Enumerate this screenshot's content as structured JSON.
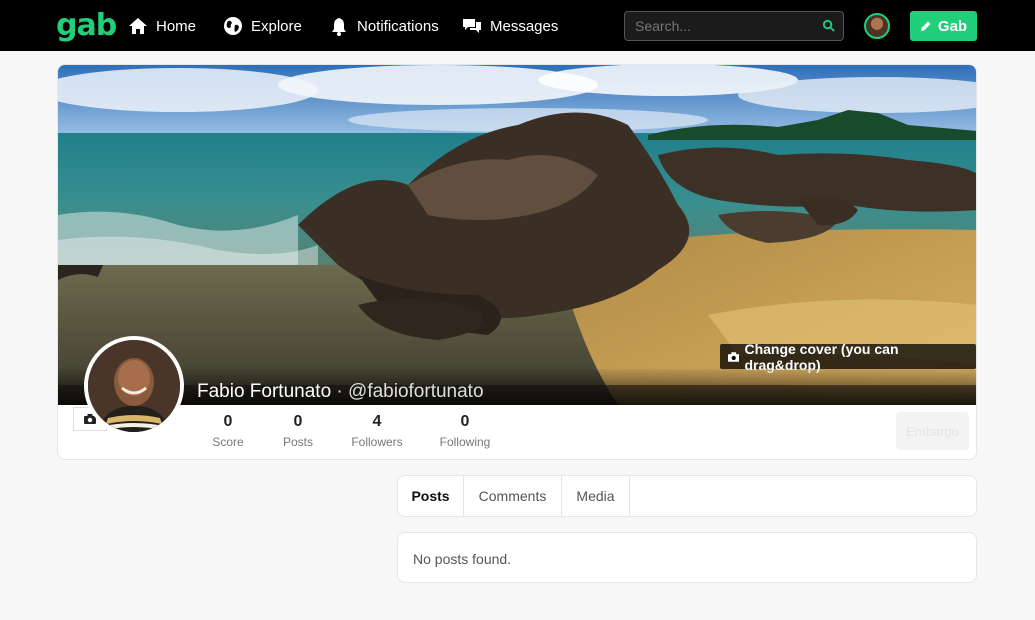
{
  "nav": {
    "logo": "gab",
    "items": [
      {
        "label": "Home",
        "icon": "home-icon"
      },
      {
        "label": "Explore",
        "icon": "globe-icon"
      },
      {
        "label": "Notifications",
        "icon": "bell-icon"
      },
      {
        "label": "Messages",
        "icon": "chat-icon"
      }
    ],
    "search_placeholder": "Search...",
    "gab_button_label": "Gab"
  },
  "profile": {
    "display_name": "Fabio Fortunato",
    "separator": "·",
    "handle": "@fabiofortunato",
    "change_cover_label": "Change cover (you can drag&drop)",
    "stats": [
      {
        "value": "0",
        "label": "Score"
      },
      {
        "value": "0",
        "label": "Posts"
      },
      {
        "value": "4",
        "label": "Followers"
      },
      {
        "value": "0",
        "label": "Following"
      }
    ],
    "action_label": "Embargo"
  },
  "tabs": [
    {
      "label": "Posts",
      "active": true
    },
    {
      "label": "Comments",
      "active": false
    },
    {
      "label": "Media",
      "active": false
    }
  ],
  "feed": {
    "empty_message": "No posts found."
  },
  "colors": {
    "brand": "#21cf7a",
    "nav_background": "#000000",
    "page_background": "#f7f7f7"
  }
}
